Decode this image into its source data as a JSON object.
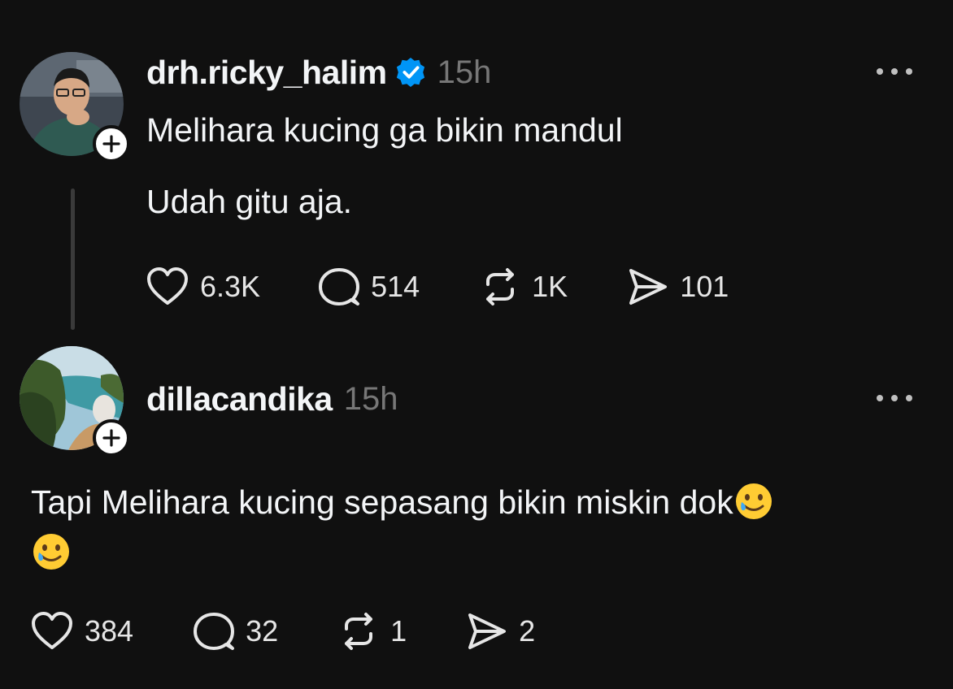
{
  "posts": [
    {
      "username": "drh.ricky_halim",
      "verified": true,
      "time": "15h",
      "text_line1": "Melihara kucing ga bikin mandul",
      "text_line2": "Udah gitu aja.",
      "likes": "6.3K",
      "replies": "514",
      "reposts": "1K",
      "shares": "101"
    },
    {
      "username": "dillacandika",
      "verified": false,
      "time": "15h",
      "text": "Tapi Melihara kucing sepasang bikin miskin dok",
      "emoji": "🥲",
      "likes": "384",
      "replies": "32",
      "reposts": "1",
      "shares": "2"
    }
  ],
  "icons": {
    "like": "heart-icon",
    "reply": "comment-bubble-icon",
    "repost": "repost-icon",
    "share": "send-icon",
    "more": "more-dots-icon",
    "follow": "plus-icon",
    "verified": "verified-badge-icon"
  },
  "colors": {
    "background": "#101010",
    "text": "#f3f5f7",
    "secondary": "#777777",
    "verified": "#0095f6"
  }
}
